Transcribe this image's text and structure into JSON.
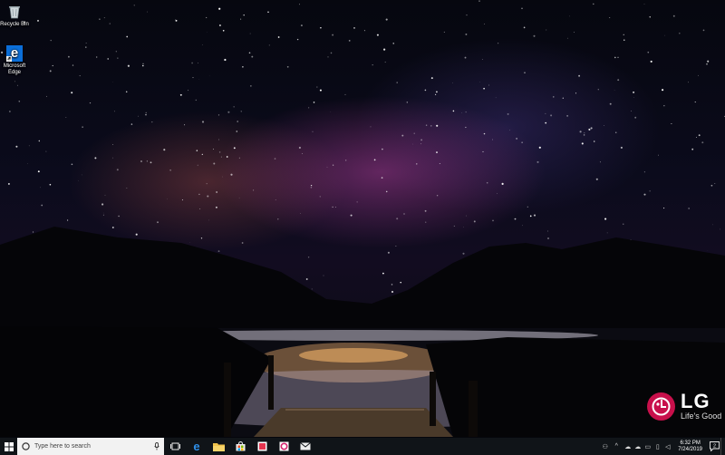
{
  "desktop": {
    "icons": [
      {
        "label": "Recycle Bin",
        "icon": "recycle-bin-icon"
      },
      {
        "label": "Microsoft Edge",
        "icon": "edge-icon"
      }
    ]
  },
  "wallpaper": {
    "brand": "LG",
    "slogan": "Life's Good",
    "brand_color": "#c8104b"
  },
  "taskbar": {
    "search_placeholder": "Type here to search",
    "pinned": [
      "task-view-icon",
      "edge-icon",
      "file-explorer-icon",
      "store-icon",
      "app-red-icon",
      "app-pink-icon",
      "mail-icon"
    ],
    "clock": {
      "time": "6:32 PM",
      "date": "7/24/2019"
    },
    "notification_count": "2",
    "accent": "#0b6ed8"
  }
}
